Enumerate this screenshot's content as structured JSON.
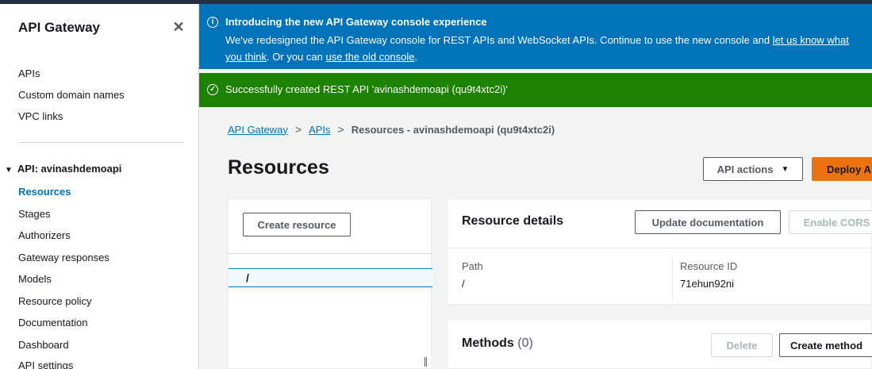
{
  "sidebar": {
    "title": "API Gateway",
    "top_items": [
      {
        "label": "APIs"
      },
      {
        "label": "Custom domain names"
      },
      {
        "label": "VPC links"
      }
    ],
    "section": {
      "caret": "▼",
      "label": "API: avinashdemoapi",
      "items": [
        {
          "label": "Resources",
          "active": true
        },
        {
          "label": "Stages"
        },
        {
          "label": "Authorizers"
        },
        {
          "label": "Gateway responses"
        },
        {
          "label": "Models"
        },
        {
          "label": "Resource policy"
        },
        {
          "label": "Documentation"
        },
        {
          "label": "Dashboard"
        },
        {
          "label": "API settings"
        }
      ]
    }
  },
  "flash_info": {
    "icon": "info-icon",
    "title": "Introducing the new API Gateway console experience",
    "body_text": "We've redesigned the API Gateway console for REST APIs and WebSocket APIs. Continue to use the new console and",
    "link_feedback": "let us know what you think",
    "middle_text": ". Or you can",
    "link_old_console": "use the old console",
    "end_text": "."
  },
  "flash_success": {
    "icon": "check-circle-icon",
    "text": "Successfully created REST API 'avinashdemoapi (qu9t4xtc2i)'"
  },
  "breadcrumb": {
    "items": [
      "API Gateway",
      "APIs"
    ],
    "separator": ">",
    "current": "Resources - avinashdemoapi (qu9t4xtc2i)"
  },
  "page": {
    "title": "Resources",
    "api_actions_label": "API actions",
    "api_actions_caret": "▼",
    "deploy_label": "Deploy A"
  },
  "tree": {
    "create_resource_label": "Create resource",
    "selected_path": "/"
  },
  "details": {
    "title": "Resource details",
    "update_doc_label": "Update documentation",
    "enable_cors_label": "Enable CORS",
    "path_label": "Path",
    "path_value": "/",
    "resource_id_label": "Resource ID",
    "resource_id_value": "71ehun92ni"
  },
  "methods": {
    "title": "Methods",
    "count": "(0)",
    "delete_label": "Delete",
    "create_label": "Create method"
  },
  "colors": {
    "info_blue": "#0073bb",
    "success_green": "#1d8102",
    "primary_orange": "#ec7211"
  }
}
